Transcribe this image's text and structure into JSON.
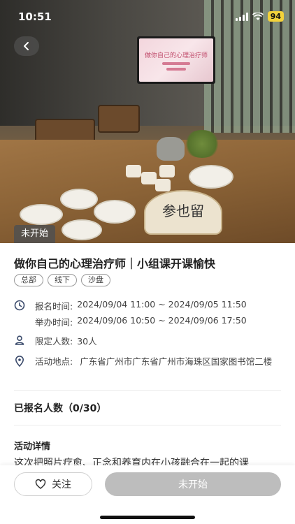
{
  "status_bar": {
    "time": "10:51",
    "battery": "94"
  },
  "hero": {
    "status_tag": "未开始",
    "screen_text": "做你自己的心理治疗师",
    "fan_text": "参也留"
  },
  "event": {
    "title": "做你自己的心理治疗师｜小组课开课愉快",
    "tags": [
      "总部",
      "线下",
      "沙盘"
    ],
    "signup_time_label": "报名时间:",
    "signup_time": "2024/09/04 11:00 ~ 2024/09/05 11:50",
    "hold_time_label": "举办时间:",
    "hold_time": "2024/09/06 10:50 ~ 2024/09/06 17:50",
    "limit_label": "限定人数:",
    "limit": "30人",
    "location_label": "活动地点:",
    "location": "广东省广州市广东省广州市海珠区国家图书馆二楼"
  },
  "registered": {
    "label": "已报名人数（0/30）"
  },
  "details": {
    "heading": "活动详情",
    "text": "这次把照片疗愈、正念和养育内在小孩融合在一起的课"
  },
  "bottom_bar": {
    "follow_label": "关注",
    "start_label": "未开始"
  },
  "icons": {
    "back": "chevron-left-icon",
    "clock": "clock-icon",
    "person": "person-icon",
    "location": "location-pin-icon",
    "follow": "heart-icon"
  },
  "colors": {
    "accent_gray": "#bdbdbd",
    "icon_blue": "#3a4a6b"
  }
}
